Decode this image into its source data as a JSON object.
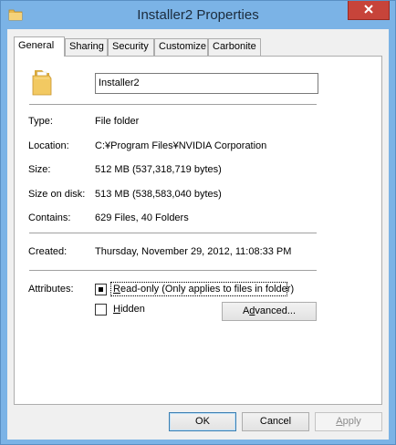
{
  "window": {
    "title": "Installer2 Properties"
  },
  "tabs": [
    {
      "label": "General",
      "active": true
    },
    {
      "label": "Sharing",
      "active": false
    },
    {
      "label": "Security",
      "active": false
    },
    {
      "label": "Customize",
      "active": false
    },
    {
      "label": "Carbonite",
      "active": false
    }
  ],
  "general": {
    "name_value": "Installer2",
    "rows": {
      "type": {
        "label": "Type:",
        "value": "File folder"
      },
      "location": {
        "label": "Location:",
        "value": "C:¥Program Files¥NVIDIA Corporation"
      },
      "size": {
        "label": "Size:",
        "value": "512 MB (537,318,719 bytes)"
      },
      "size_on_disk": {
        "label": "Size on disk:",
        "value": "513 MB (538,583,040 bytes)"
      },
      "contains": {
        "label": "Contains:",
        "value": "629 Files, 40 Folders"
      },
      "created": {
        "label": "Created:",
        "value": "Thursday, November 29, 2012, 11:08:33 PM"
      }
    },
    "attributes": {
      "label": "Attributes:",
      "read_only": {
        "mnemonic": "R",
        "rest": "ead-only (Only applies to files in folder)",
        "state": "indeterminate"
      },
      "hidden": {
        "mnemonic": "H",
        "rest": "idden",
        "checked": false
      },
      "advanced_button": {
        "before": "A",
        "mnemonic": "d",
        "after": "vanced..."
      }
    }
  },
  "footer": {
    "ok_label": "OK",
    "cancel_label": "Cancel",
    "apply": {
      "mnemonic": "A",
      "rest": "pply",
      "enabled": false
    }
  },
  "colors": {
    "titlebar": "#7bb3e6",
    "close_button": "#c7443a",
    "folder": "#f2c962"
  },
  "icons": [
    "folder-icon",
    "close-icon"
  ]
}
